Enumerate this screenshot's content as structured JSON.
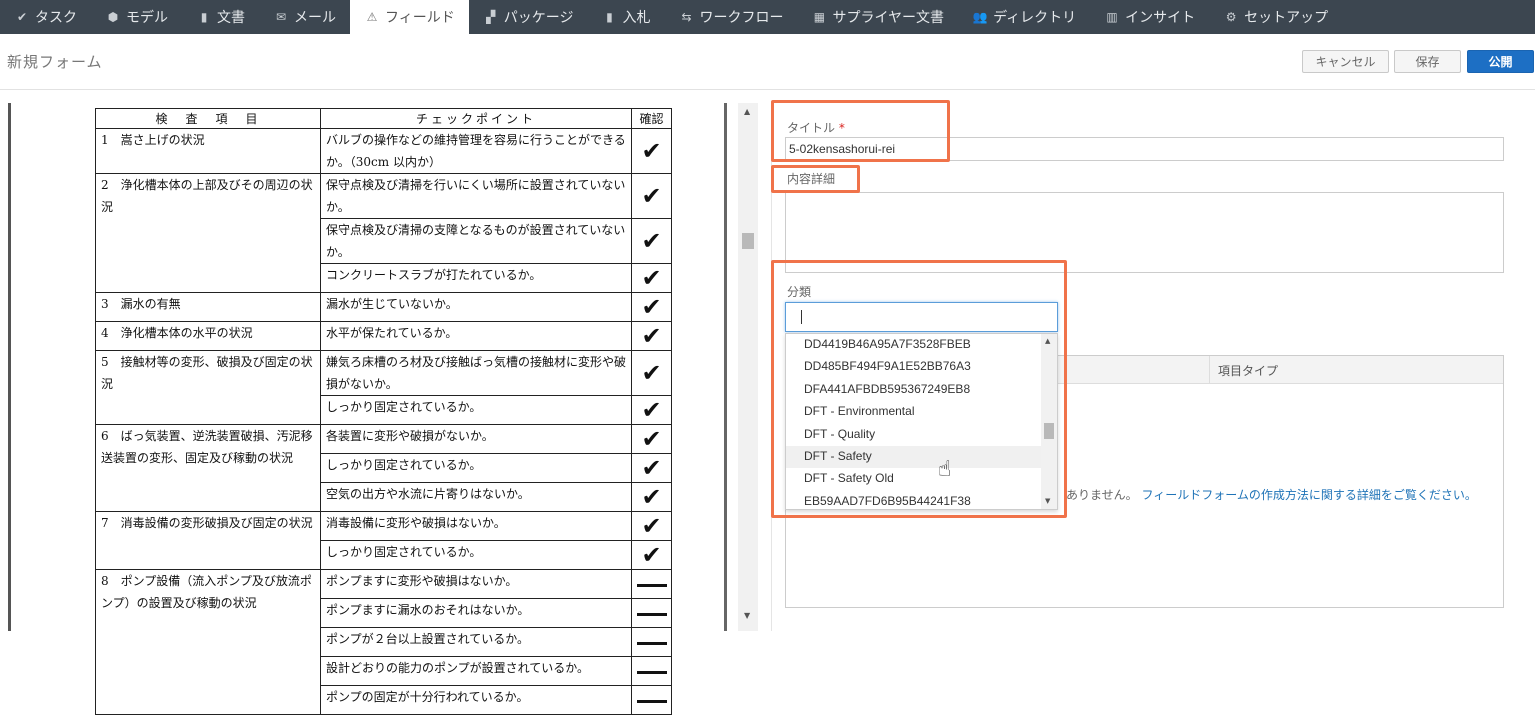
{
  "nav": {
    "items": [
      {
        "label": "タスク",
        "icon": "✔"
      },
      {
        "label": "モデル",
        "icon": "⬢"
      },
      {
        "label": "文書",
        "icon": "▮"
      },
      {
        "label": "メール",
        "icon": "✉"
      },
      {
        "label": "フィールド",
        "icon": "⚠",
        "active": true
      },
      {
        "label": "パッケージ",
        "icon": "▞"
      },
      {
        "label": "入札",
        "icon": "▮"
      },
      {
        "label": "ワークフロー",
        "icon": "⇆"
      },
      {
        "label": "サプライヤー文書",
        "icon": "▦"
      },
      {
        "label": "ディレクトリ",
        "icon": "👥"
      },
      {
        "label": "インサイト",
        "icon": "▥"
      },
      {
        "label": "セットアップ",
        "icon": "⚙"
      }
    ],
    "bg_color": "#3c4650"
  },
  "page": {
    "title": "新規フォーム",
    "cancel_label": "キャンセル",
    "save_label": "保存",
    "publish_label": "公開",
    "publish_color": "#1d6fc4"
  },
  "document": {
    "header": [
      "検　査　項　目",
      "チェックポイント",
      "確認"
    ],
    "rows": [
      {
        "item": "1　嵩さ上げの状況",
        "points": [
          "バルブの操作などの維持管理を容易に行うことができるか。（30cm 以内か）"
        ],
        "marks": [
          "check"
        ]
      },
      {
        "item": "2　浄化槽本体の上部及びその周辺の状況",
        "points": [
          "保守点検及び清掃を行いにくい場所に設置されていないか。",
          "保守点検及び清掃の支障となるものが設置されていないか。",
          "コンクリートスラブが打たれているか。"
        ],
        "marks": [
          "check",
          "check",
          "check"
        ]
      },
      {
        "item": "3　漏水の有無",
        "points": [
          "漏水が生じていないか。"
        ],
        "marks": [
          "check"
        ]
      },
      {
        "item": "4　浄化槽本体の水平の状況",
        "points": [
          "水平が保たれているか。"
        ],
        "marks": [
          "check"
        ]
      },
      {
        "item": "5　接触材等の変形、破損及び固定の状況",
        "points": [
          "嫌気ろ床槽のろ材及び接触ばっ気槽の接触材に変形や破損がないか。",
          "しっかり固定されているか。"
        ],
        "marks": [
          "check",
          "check"
        ]
      },
      {
        "item": "6　ばっ気装置、逆洗装置破損、汚泥移送装置の変形、固定及び稼動の状況",
        "points": [
          "各装置に変形や破損がないか。",
          "しっかり固定されているか。",
          "空気の出方や水流に片寄りはないか。"
        ],
        "marks": [
          "check",
          "check",
          "check"
        ]
      },
      {
        "item": "7　消毒設備の変形破損及び固定の状況",
        "points": [
          "消毒設備に変形や破損はないか。",
          "しっかり固定されているか。"
        ],
        "marks": [
          "check",
          "check"
        ]
      },
      {
        "item": "8　ポンプ設備（流入ポンプ及び放流ポンプ）の設置及び稼動の状況",
        "points": [
          "ポンプますに変形や破損はないか。",
          "ポンプますに漏水のおそれはないか。",
          "ポンプが２台以上設置されているか。",
          "設計どおりの能力のポンプが設置されているか。",
          "ポンプの固定が十分行われているか。"
        ],
        "marks": [
          "dash",
          "dash",
          "dash",
          "dash",
          "dash"
        ]
      }
    ]
  },
  "form": {
    "title_label": "タイトル",
    "required_mark": "*",
    "title_value": "5-02kensashorui-rei",
    "desc_label": "内容詳細",
    "category_label": "分類",
    "items_col_type": "項目タイプ",
    "empty_text": "ありません。",
    "empty_link": "フィールドフォームの作成方法に関する詳細をご覧ください。"
  },
  "dropdown": {
    "options": [
      "DD4419B46A95A7F3528FBEB",
      "DD485BF494F9A1E52BB76A3",
      "DFA441AFBDB595367249EB8",
      "DFT - Environmental",
      "DFT - Quality",
      "DFT - Safety",
      "DFT - Safety Old",
      "EB59AAD7FD6B95B44241F38"
    ],
    "hovered": "DFT - Safety"
  },
  "highlight_color": "#f0734a"
}
